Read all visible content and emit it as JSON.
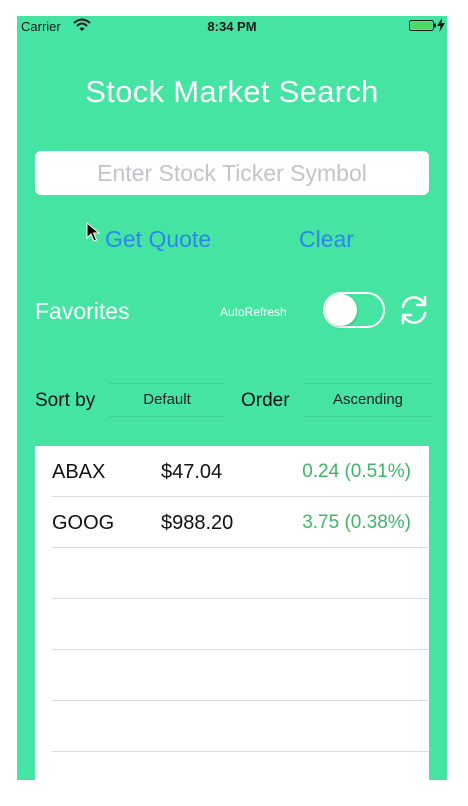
{
  "status_bar": {
    "carrier": "Carrier",
    "time": "8:34 PM"
  },
  "title": "Stock Market Search",
  "search": {
    "placeholder": "Enter Stock Ticker Symbol",
    "value": ""
  },
  "actions": {
    "get_quote": "Get Quote",
    "clear": "Clear"
  },
  "favorites": {
    "label": "Favorites",
    "autorefresh_label": "AutoRefresh",
    "autorefresh_on": false
  },
  "sort": {
    "sort_label": "Sort by",
    "sort_value": "Default",
    "order_label": "Order",
    "order_value": "Ascending"
  },
  "stocks": [
    {
      "symbol": "ABAX",
      "price": "$47.04",
      "change": "0.24 (0.51%)"
    },
    {
      "symbol": "GOOG",
      "price": "$988.20",
      "change": "3.75 (0.38%)"
    }
  ],
  "colors": {
    "background": "#45e4a3",
    "link": "#2b86ee",
    "positive": "#3cb567"
  }
}
